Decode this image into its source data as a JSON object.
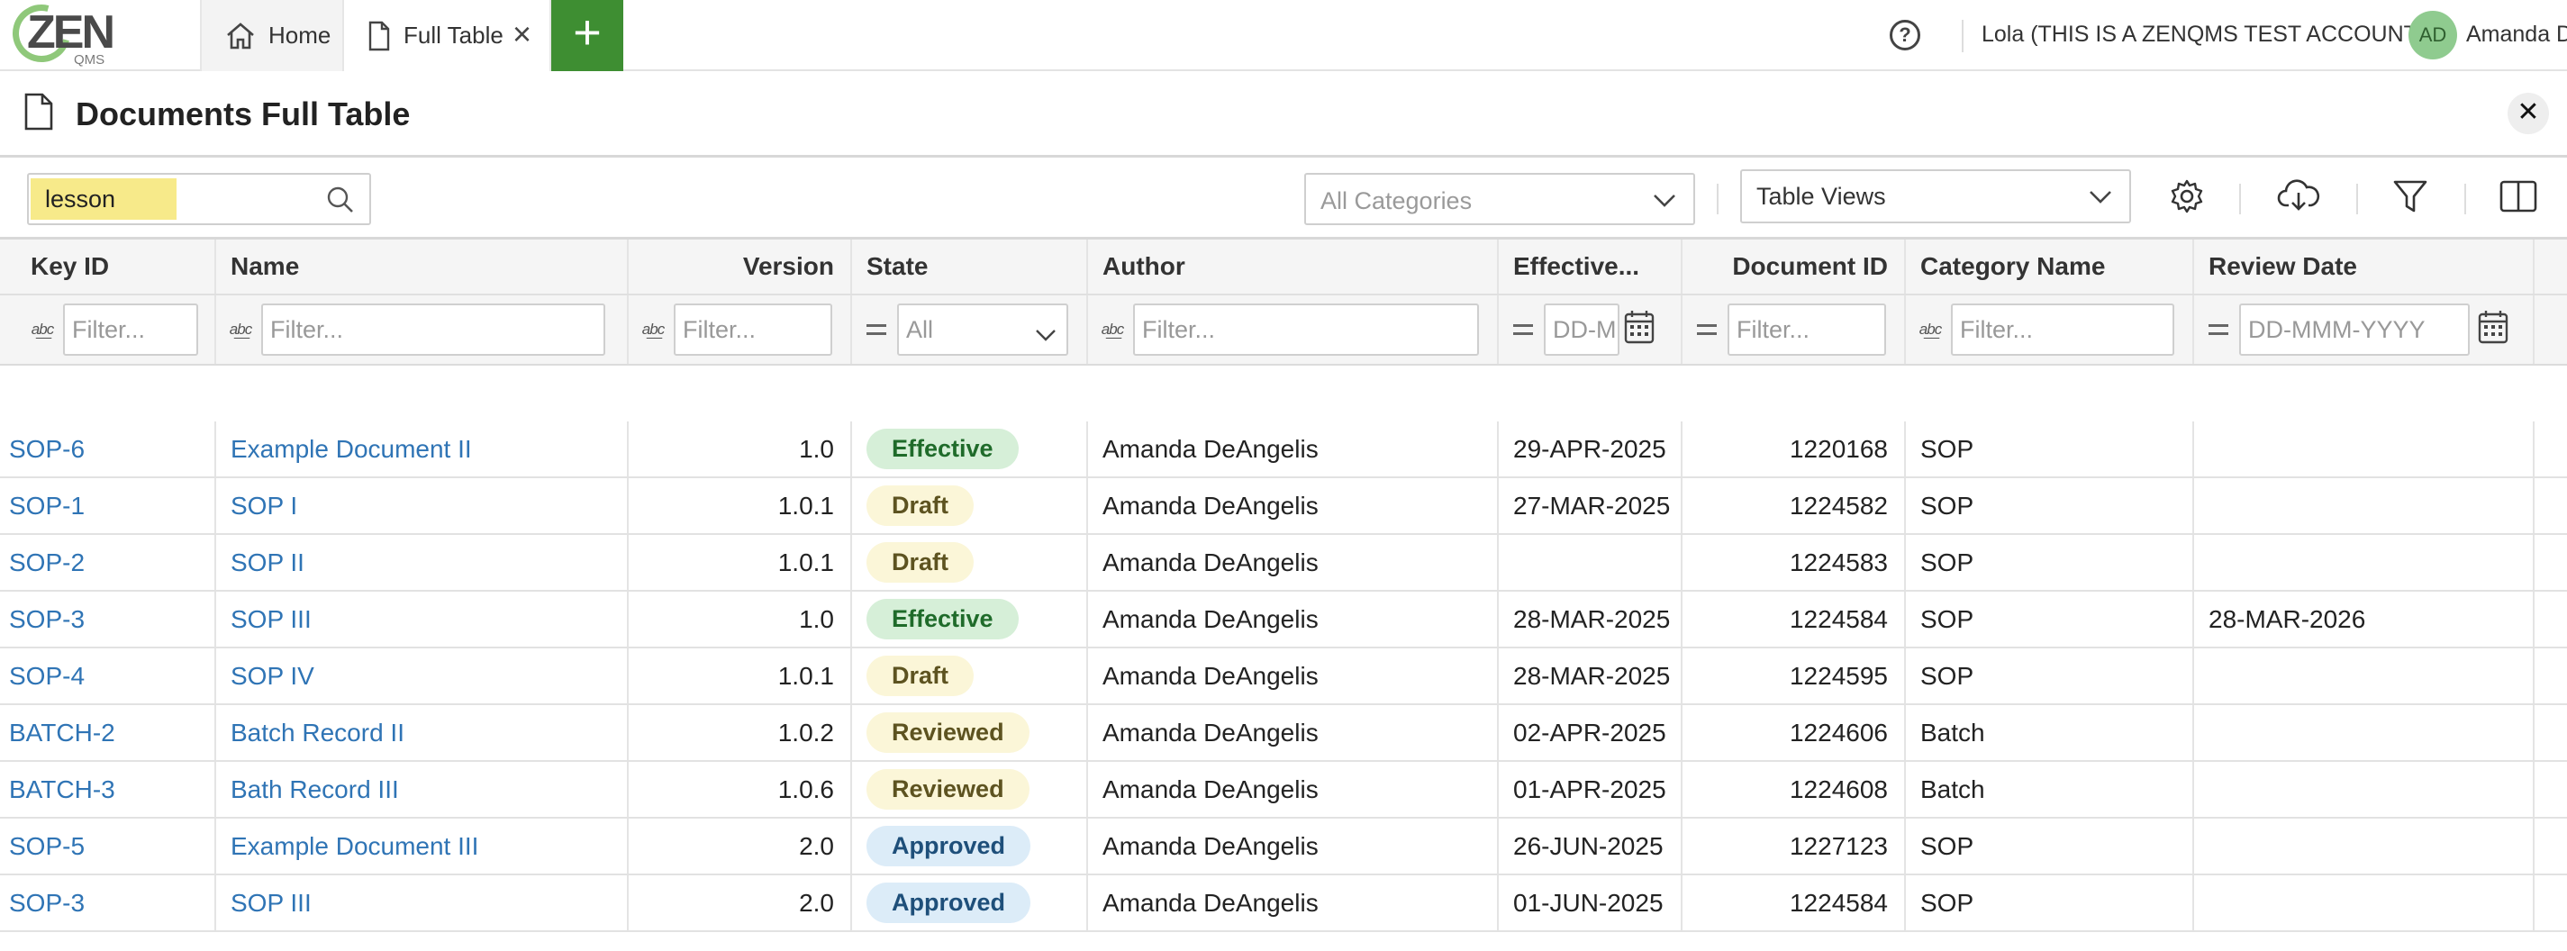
{
  "app": {
    "logo_text": "ZEN",
    "logo_sub": "QMS",
    "tabs": [
      {
        "label": "Home"
      },
      {
        "label": "Full Table"
      }
    ],
    "account_label": "Lola (THIS IS A ZENQMS TEST ACCOUNT)",
    "avatar_initials": "AD",
    "user_name": "Amanda D",
    "accent_color": "#3e8e32"
  },
  "page": {
    "title": "Documents Full Table"
  },
  "toolbar": {
    "search_value": "lesson",
    "category_placeholder": "All Categories",
    "table_views_value": "Table Views"
  },
  "table": {
    "columns": [
      "Key ID",
      "Name",
      "Version",
      "State",
      "Author",
      "Effective...",
      "Document ID",
      "Category Name",
      "Review Date"
    ],
    "filters": {
      "key_id": "Filter...",
      "name": "Filter...",
      "version": "Filter...",
      "state": "All",
      "author": "Filter...",
      "effective": "DD-M",
      "document_id": "Filter...",
      "category": "Filter...",
      "review_date": "DD-MMM-YYYY"
    },
    "state_colors": {
      "Effective": {
        "bg": "#d6efd8",
        "fg": "#1f6b2a"
      },
      "Draft": {
        "bg": "#fbf6d8",
        "fg": "#5d5320"
      },
      "Reviewed": {
        "bg": "#fbf6d8",
        "fg": "#5d5320"
      },
      "Approved": {
        "bg": "#dcecf8",
        "fg": "#1e4f7a"
      }
    },
    "rows": [
      {
        "key": "SOP-6",
        "name": "Example Document II",
        "version": "1.0",
        "state": "Effective",
        "author": "Amanda DeAngelis",
        "effective": "29-APR-2025",
        "doc_id": "1220168",
        "category": "SOP",
        "review": ""
      },
      {
        "key": "SOP-1",
        "name": "SOP I",
        "version": "1.0.1",
        "state": "Draft",
        "author": "Amanda DeAngelis",
        "effective": "27-MAR-2025",
        "doc_id": "1224582",
        "category": "SOP",
        "review": ""
      },
      {
        "key": "SOP-2",
        "name": "SOP II",
        "version": "1.0.1",
        "state": "Draft",
        "author": "Amanda DeAngelis",
        "effective": "",
        "doc_id": "1224583",
        "category": "SOP",
        "review": ""
      },
      {
        "key": "SOP-3",
        "name": "SOP III",
        "version": "1.0",
        "state": "Effective",
        "author": "Amanda DeAngelis",
        "effective": "28-MAR-2025",
        "doc_id": "1224584",
        "category": "SOP",
        "review": "28-MAR-2026"
      },
      {
        "key": "SOP-4",
        "name": "SOP IV",
        "version": "1.0.1",
        "state": "Draft",
        "author": "Amanda DeAngelis",
        "effective": "28-MAR-2025",
        "doc_id": "1224595",
        "category": "SOP",
        "review": ""
      },
      {
        "key": "BATCH-2",
        "name": "Batch Record II",
        "version": "1.0.2",
        "state": "Reviewed",
        "author": "Amanda DeAngelis",
        "effective": "02-APR-2025",
        "doc_id": "1224606",
        "category": "Batch",
        "review": ""
      },
      {
        "key": "BATCH-3",
        "name": "Bath Record III",
        "version": "1.0.6",
        "state": "Reviewed",
        "author": "Amanda DeAngelis",
        "effective": "01-APR-2025",
        "doc_id": "1224608",
        "category": "Batch",
        "review": ""
      },
      {
        "key": "SOP-5",
        "name": "Example Document III",
        "version": "2.0",
        "state": "Approved",
        "author": "Amanda DeAngelis",
        "effective": "26-JUN-2025",
        "doc_id": "1227123",
        "category": "SOP",
        "review": ""
      },
      {
        "key": "SOP-3",
        "name": "SOP III",
        "version": "2.0",
        "state": "Approved",
        "author": "Amanda DeAngelis",
        "effective": "01-JUN-2025",
        "doc_id": "1224584",
        "category": "SOP",
        "review": ""
      }
    ]
  }
}
